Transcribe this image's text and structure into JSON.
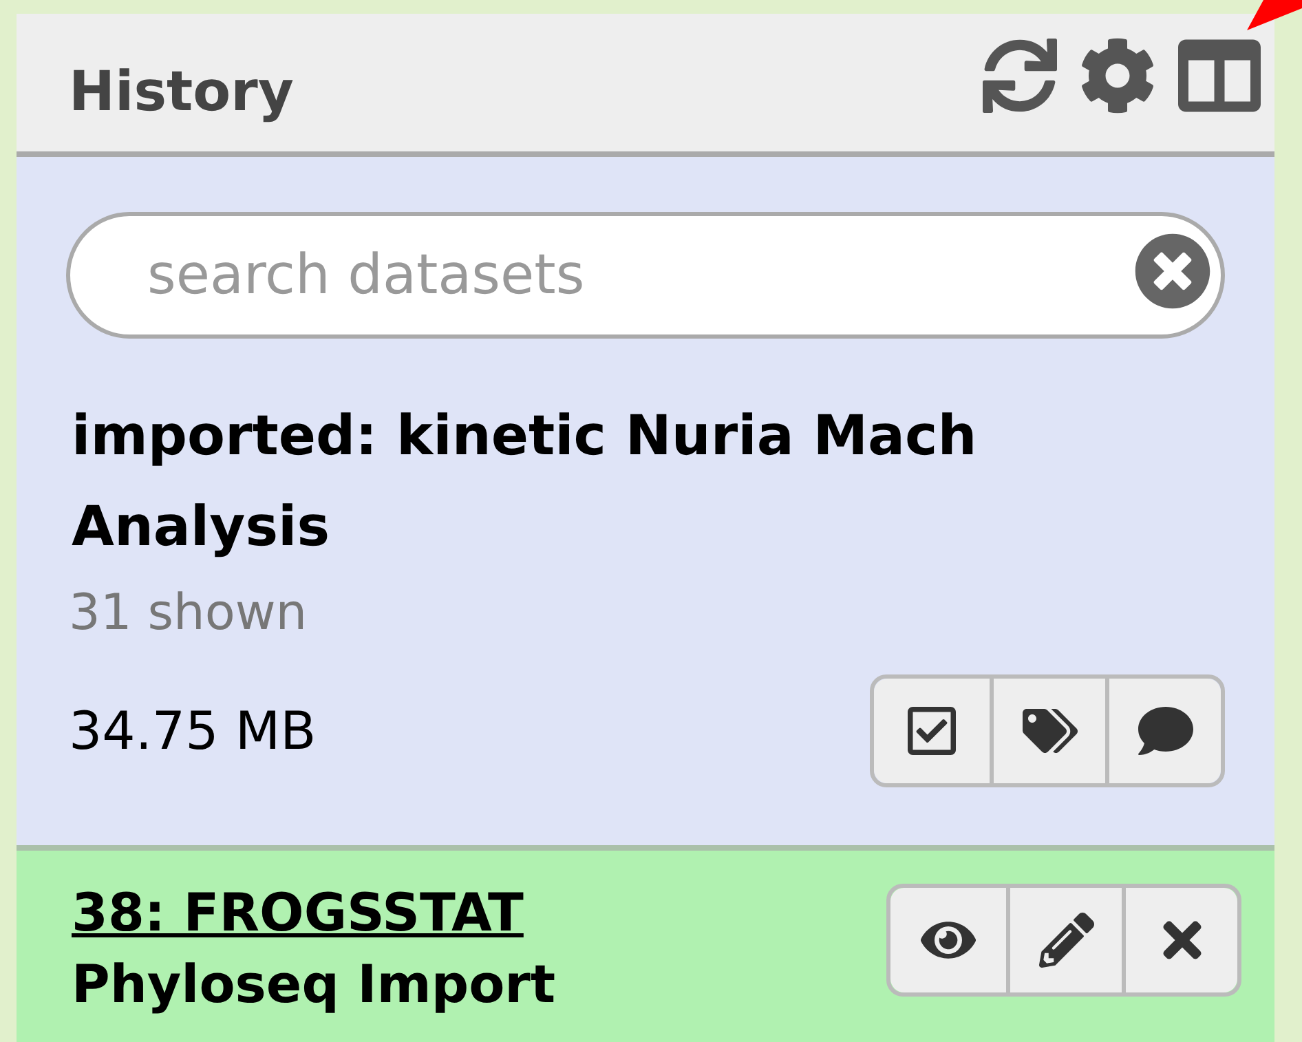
{
  "header": {
    "title": "History"
  },
  "search": {
    "placeholder": "search datasets"
  },
  "history": {
    "name": "imported: kinetic Nuria Mach Analysis",
    "shown": "31 shown",
    "size": "34.75 MB"
  },
  "datasets": [
    {
      "title": "38: FROGSSTAT",
      "subtitle": "Phyloseq Import",
      "color": "#b0f1b0"
    }
  ]
}
